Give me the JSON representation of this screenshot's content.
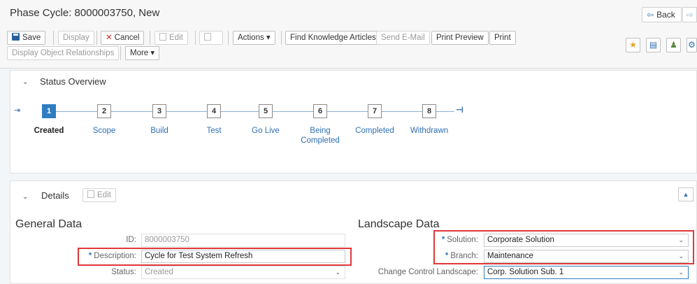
{
  "title": "Phase Cycle: 8000003750, New",
  "nav": {
    "back_label": "Back"
  },
  "toolbar": {
    "save": "Save",
    "display": "Display",
    "cancel": "Cancel",
    "edit": "Edit",
    "actions": "Actions ▾",
    "find_knowledge": "Find Knowledge Articles",
    "send_email": "Send E-Mail",
    "print_preview": "Print Preview",
    "print": "Print",
    "display_relationships": "Display Object Relationships",
    "more": "More ▾"
  },
  "status_overview": {
    "title": "Status Overview",
    "steps": [
      {
        "num": "1",
        "label": "Created",
        "active": true
      },
      {
        "num": "2",
        "label": "Scope"
      },
      {
        "num": "3",
        "label": "Build"
      },
      {
        "num": "4",
        "label": "Test"
      },
      {
        "num": "5",
        "label": "Go Live"
      },
      {
        "num": "6",
        "label": "Being Completed"
      },
      {
        "num": "7",
        "label": "Completed"
      },
      {
        "num": "8",
        "label": "Withdrawn"
      }
    ]
  },
  "details": {
    "title": "Details",
    "edit_label": "Edit",
    "general": {
      "title": "General Data",
      "id_label": "ID:",
      "id_value": "8000003750",
      "description_label": "Description:",
      "description_value": "Cycle for Test System Refresh",
      "status_label": "Status:",
      "status_value": "Created"
    },
    "landscape": {
      "title": "Landscape Data",
      "solution_label": "Solution:",
      "solution_value": "Corporate Solution",
      "branch_label": "Branch:",
      "branch_value": "Maintenance",
      "ccl_label": "Change Control Landscape:",
      "ccl_value": "Corp. Solution Sub. 1"
    }
  },
  "colors": {
    "accent": "#2f7dc1",
    "highlight": "#e0373a"
  }
}
